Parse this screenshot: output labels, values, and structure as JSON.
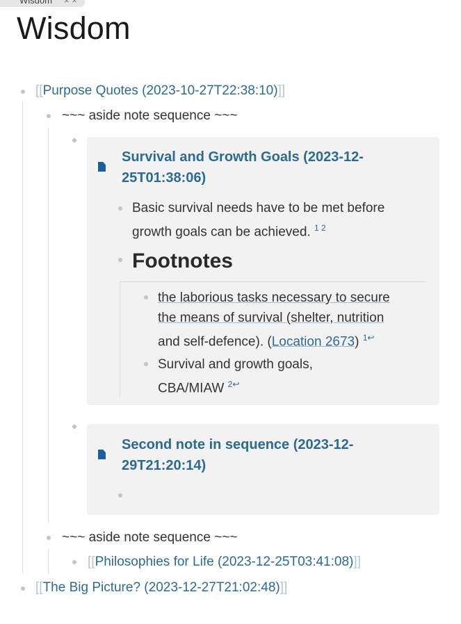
{
  "tab": {
    "label": "Wisdom",
    "close": "× ×"
  },
  "page": {
    "title": "Wisdom"
  },
  "outline": {
    "item1": {
      "open": "[[",
      "label": "Purpose Quotes (2023-10-27T22:38:10)",
      "close": "]]"
    },
    "aside1": {
      "label": "~~~ aside note sequence ~~~"
    },
    "card1": {
      "title_line1": "Survival and Growth Goals (2023-12-",
      "title_line2": "25T01:38:06)",
      "body_line1": "Basic survival needs have to be met before",
      "body_line2": "growth goals can be achieved.",
      "body_refs": "1 2",
      "footnotes_heading": "Footnotes",
      "fn1_line1": "the laborious tasks necessary to secure",
      "fn1_line2": "the means of survival (shelter, nutrition",
      "fn1_line3_pre": "and self-defence). (",
      "fn1_link": "Location 2673",
      "fn1_line3_post": ")",
      "fn1_backref": "1↩",
      "fn2_line1": "Survival and growth goals,",
      "fn2_line2": "CBA/MIAW",
      "fn2_backref": "2↩"
    },
    "card2": {
      "title_line1": "Second note in sequence (2023-12-",
      "title_line2": "29T21:20:14)"
    },
    "aside2": {
      "label": "~~~ aside note sequence ~~~"
    },
    "item_phil": {
      "open": "[[",
      "label": "Philosophies for Life (2023-12-25T03:41:08)",
      "close": "]]"
    },
    "item2": {
      "open": "[[",
      "label": "The Big Picture? (2023-12-27T21:02:48)",
      "close": "]]"
    }
  },
  "colors": {
    "link": "#2c6a93",
    "icon": "#1f5e9c",
    "card_bg": "#f2f2f2"
  },
  "icons": [
    "document-icon"
  ]
}
